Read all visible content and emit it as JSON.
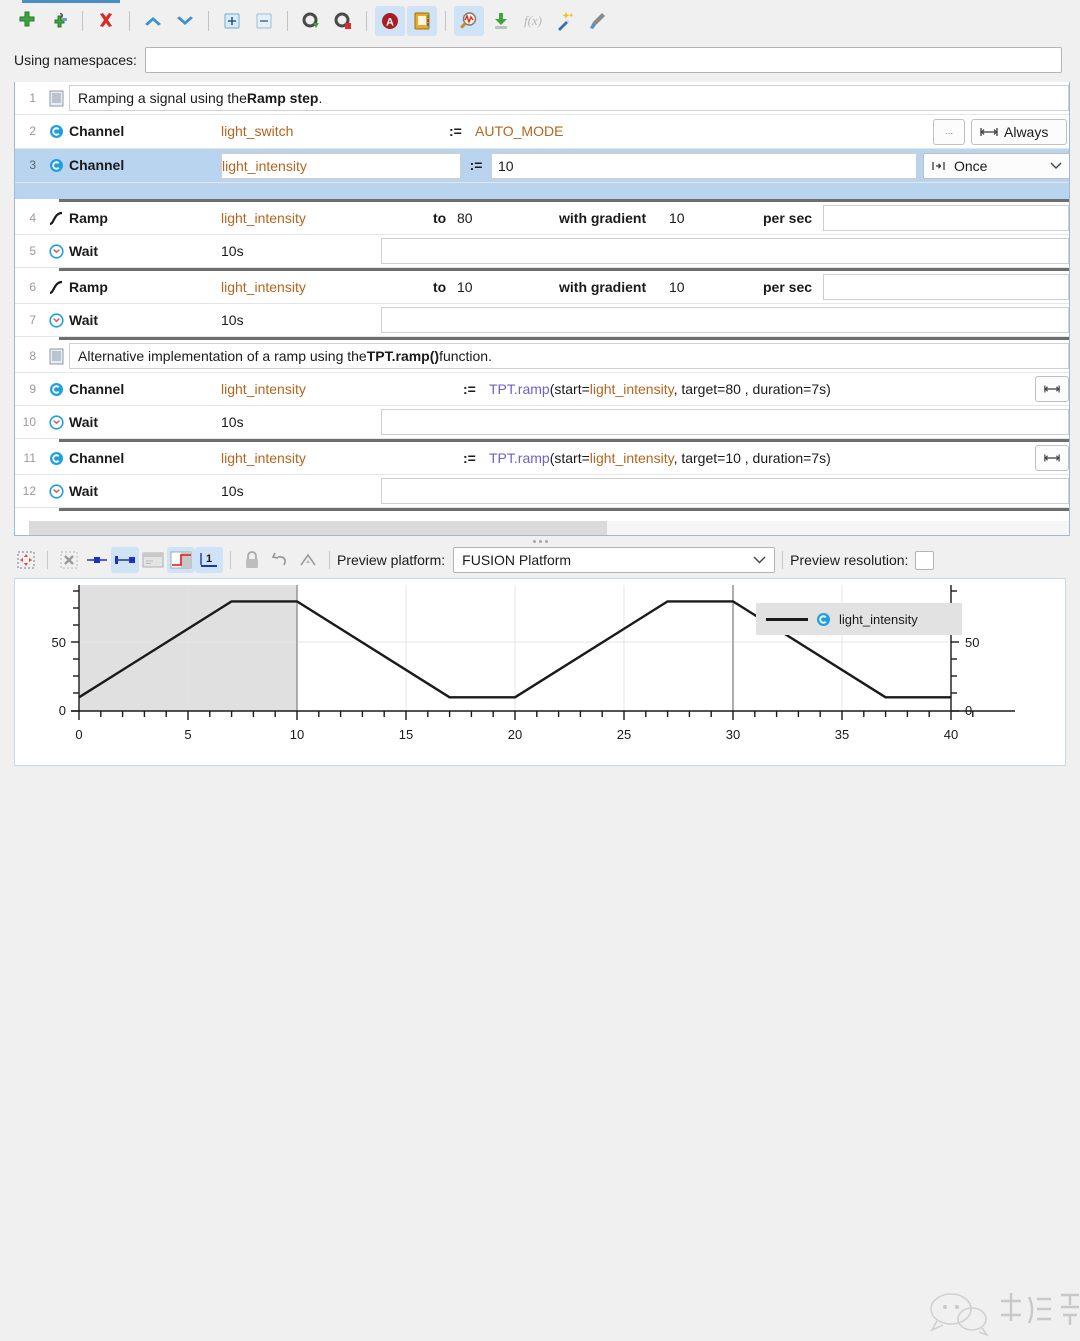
{
  "toolbar": {
    "items": [
      {
        "name": "add-step-icon",
        "glyph": "plus-green",
        "active": false
      },
      {
        "name": "add-step-from-library-icon",
        "glyph": "plug-green",
        "active": false
      },
      {
        "name": "delete-step-icon",
        "glyph": "x-red",
        "active": false
      },
      {
        "name": "move-up-icon",
        "glyph": "chevron-up-blue",
        "active": false
      },
      {
        "name": "move-down-icon",
        "glyph": "chevron-down-blue",
        "active": false
      },
      {
        "name": "expand-icon",
        "glyph": "plus-box",
        "active": false
      },
      {
        "name": "collapse-icon",
        "glyph": "minus-box",
        "active": false
      },
      {
        "name": "settings-run-icon",
        "glyph": "gear-green",
        "active": false
      },
      {
        "name": "settings-stop-icon",
        "glyph": "gear-red",
        "active": false
      },
      {
        "name": "assessment-icon",
        "glyph": "a-circle-red",
        "active": true
      },
      {
        "name": "notebook-icon",
        "glyph": "notebook-yellow",
        "active": true
      },
      {
        "name": "signal-inspect-icon",
        "glyph": "magnifier-signal",
        "active": true
      },
      {
        "name": "download-icon",
        "glyph": "download-green",
        "active": false
      },
      {
        "name": "function-icon",
        "glyph": "fx",
        "active": false
      },
      {
        "name": "wand-icon",
        "glyph": "magic-wand",
        "active": false
      },
      {
        "name": "brush-icon",
        "glyph": "paint-brush",
        "active": false
      }
    ]
  },
  "namespaces": {
    "label": "Using namespaces:",
    "value": "",
    "placeholder": ""
  },
  "script": {
    "rows": [
      {
        "num": "1",
        "kind": "comment",
        "icon": "document-icon",
        "text_plain_1": "Ramping a signal using the ",
        "text_bold": "Ramp step",
        "text_plain_2": "."
      },
      {
        "num": "2",
        "kind": "channel",
        "icon": "channel-icon",
        "keyword": "Channel",
        "channel": "light_switch",
        "assign": ":=",
        "value": "AUTO_MODE",
        "ellipsis": "...",
        "mode_icon": "always-icon",
        "mode": "Always"
      },
      {
        "num": "3",
        "kind": "channel",
        "icon": "channel-icon",
        "selected": true,
        "keyword": "Channel",
        "channel": "light_intensity",
        "assign": ":=",
        "value": "10",
        "mode_icon": "once-icon",
        "mode": "Once"
      },
      {
        "num": "4",
        "kind": "ramp",
        "icon": "ramp-icon",
        "keyword": "Ramp",
        "channel": "light_intensity",
        "to_label": "to",
        "to_value": "80",
        "grad_label": "with gradient",
        "grad_value": "10",
        "per_label": "per sec"
      },
      {
        "num": "5",
        "kind": "wait",
        "icon": "clock-icon",
        "keyword": "Wait",
        "duration": "10s"
      },
      {
        "num": "6",
        "kind": "ramp",
        "icon": "ramp-icon",
        "keyword": "Ramp",
        "channel": "light_intensity",
        "to_label": "to",
        "to_value": "10",
        "grad_label": "with gradient",
        "grad_value": "10",
        "per_label": "per sec"
      },
      {
        "num": "7",
        "kind": "wait",
        "icon": "clock-icon",
        "keyword": "Wait",
        "duration": "10s"
      },
      {
        "num": "8",
        "kind": "comment",
        "icon": "document-icon",
        "text_plain_1": "Alternative implementation of a ramp using the ",
        "text_bold": "TPT.ramp()",
        "text_plain_2": " function."
      },
      {
        "num": "9",
        "kind": "channel-fn",
        "icon": "channel-icon",
        "keyword": "Channel",
        "channel": "light_intensity",
        "assign": ":=",
        "fn_name": "TPT.ramp",
        "fn_open": "(start=",
        "fn_arg1": "light_intensity",
        "fn_mid": ", target=80 , duration=7s)",
        "mode_icon": "always-icon"
      },
      {
        "num": "10",
        "kind": "wait",
        "icon": "clock-icon",
        "keyword": "Wait",
        "duration": "10s"
      },
      {
        "num": "11",
        "kind": "channel-fn",
        "icon": "channel-icon",
        "keyword": "Channel",
        "channel": "light_intensity",
        "assign": ":=",
        "fn_name": "TPT.ramp",
        "fn_open": "(start=",
        "fn_arg1": "light_intensity",
        "fn_mid": ", target=10 , duration=7s)",
        "mode_icon": "always-icon"
      },
      {
        "num": "12",
        "kind": "wait",
        "icon": "clock-icon",
        "keyword": "Wait",
        "duration": "10s"
      }
    ]
  },
  "preview_toolbar": {
    "buttons": [
      {
        "name": "fit-view-icon",
        "glyph": "fit",
        "active": false
      },
      {
        "name": "clear-icon",
        "glyph": "x-grey",
        "active": false
      },
      {
        "name": "marker-single-icon",
        "glyph": "marker-single",
        "active": false
      },
      {
        "name": "marker-range-icon",
        "glyph": "marker-range",
        "active": true
      },
      {
        "name": "window-icon",
        "glyph": "window-grey",
        "active": false
      },
      {
        "name": "step-signal-icon",
        "glyph": "step-red",
        "active": true
      },
      {
        "name": "digital-signal-icon",
        "glyph": "digital-blue",
        "active": true
      },
      {
        "name": "lock-icon",
        "glyph": "lock-grey",
        "active": false
      },
      {
        "name": "undo-icon",
        "glyph": "undo-grey",
        "active": false
      },
      {
        "name": "peak-icon",
        "glyph": "peak-grey",
        "active": false
      }
    ],
    "platform_label": "Preview platform:",
    "platform_value": "FUSION Platform",
    "resolution_label": "Preview resolution:",
    "resolution_checked": false
  },
  "colors": {
    "channel_orange": "#b5651d",
    "function_purple": "#6b63c7",
    "selection_blue": "#b8d4ee",
    "accent_blue": "#4a8fc4",
    "signal_black": "#1a1a1a",
    "shaded_region": "#e0e0e0"
  },
  "chart_data": {
    "type": "line",
    "title": "",
    "xlabel": "",
    "ylabel": "",
    "xlim": [
      0,
      41.5
    ],
    "ylim": [
      0,
      92
    ],
    "xticks": [
      0,
      5,
      10,
      15,
      20,
      25,
      30,
      35,
      40
    ],
    "yticks_left": [
      0,
      50
    ],
    "yticks_right": [
      0,
      50
    ],
    "grid": true,
    "legend": {
      "position": "top-right",
      "entries": [
        "light_intensity"
      ]
    },
    "shaded_region": {
      "x0": 0,
      "x1": 10
    },
    "cursors": [
      10,
      30
    ],
    "series": [
      {
        "name": "light_intensity",
        "color": "#1a1a1a",
        "x": [
          0,
          7,
          10,
          17,
          20,
          27,
          30,
          37,
          40
        ],
        "y": [
          10,
          80,
          80,
          10,
          10,
          80,
          80,
          10,
          10
        ]
      }
    ]
  }
}
